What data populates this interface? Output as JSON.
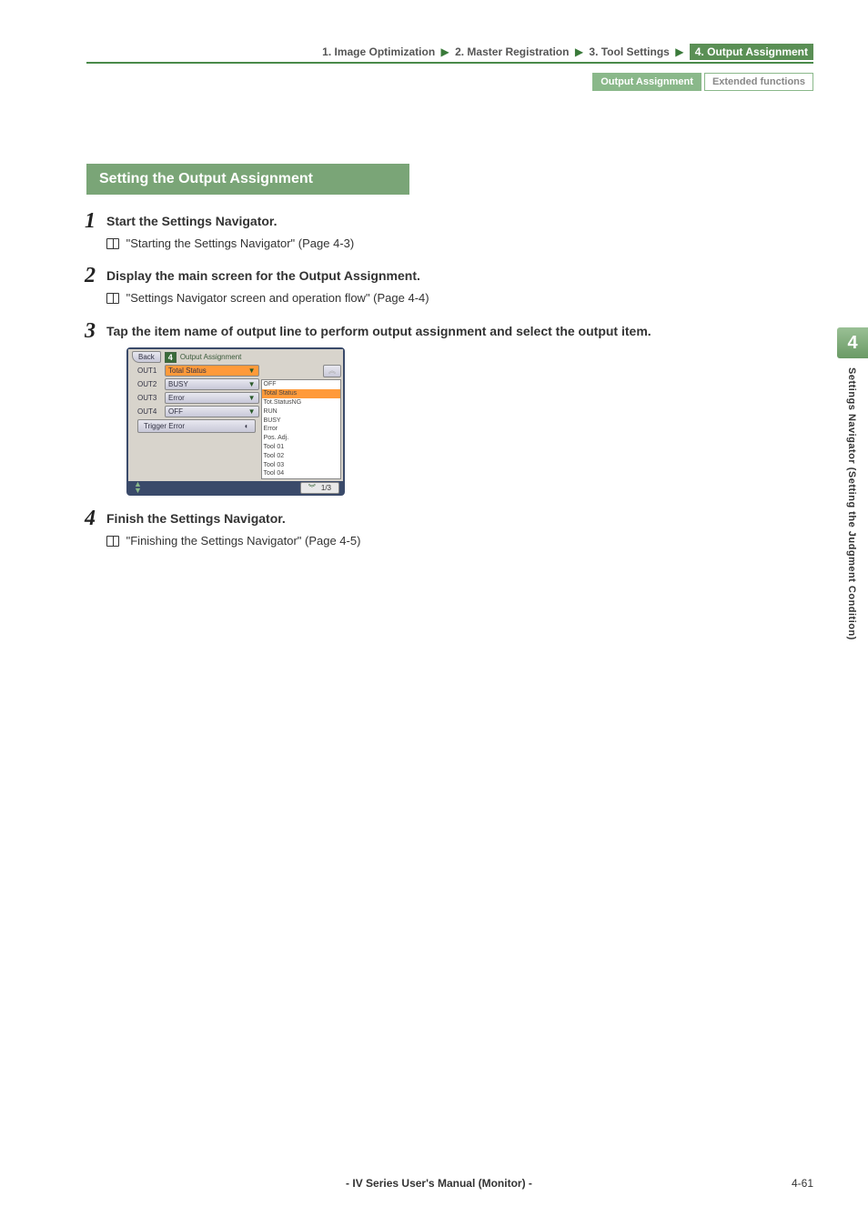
{
  "breadcrumb": {
    "items": [
      "1. Image Optimization",
      "2. Master Registration",
      "3. Tool Settings",
      "4. Output Assignment"
    ],
    "active_index": 3
  },
  "subtabs": {
    "items": [
      "Output Assignment",
      "Extended functions"
    ],
    "active_index": 0
  },
  "section_heading": "Setting the Output Assignment",
  "steps": [
    {
      "num": "1",
      "title": "Start the Settings Navigator.",
      "ref": "\"Starting the Settings Navigator\" (Page 4-3)"
    },
    {
      "num": "2",
      "title": "Display the main screen for the Output Assignment.",
      "ref": "\"Settings Navigator screen and operation flow\" (Page 4-4)"
    },
    {
      "num": "3",
      "title": "Tap the item name of output line to perform output assignment and select the output item.",
      "ref": ""
    },
    {
      "num": "4",
      "title": "Finish the Settings Navigator.",
      "ref": "\"Finishing the Settings Navigator\" (Page 4-5)"
    }
  ],
  "device": {
    "back": "Back",
    "stage_num": "4",
    "stage_title": "Output Assignment",
    "rows": [
      {
        "label": "OUT1",
        "value": "Total Status",
        "selected": true
      },
      {
        "label": "OUT2",
        "value": "BUSY",
        "selected": false
      },
      {
        "label": "OUT3",
        "value": "Error",
        "selected": false
      },
      {
        "label": "OUT4",
        "value": "OFF",
        "selected": false
      }
    ],
    "trigger_label": "Trigger Error",
    "dropdown": [
      "OFF",
      "Total Status",
      "Tot.StatusNG",
      "RUN",
      "BUSY",
      "Error",
      "Pos. Adj.",
      "Tool 01",
      "Tool 02",
      "Tool 03",
      "Tool 04"
    ],
    "dropdown_selected_index": 1,
    "page_indicator": "1/3"
  },
  "sidetab": {
    "num": "4",
    "text": "Settings Navigator (Setting the Judgment Condition)"
  },
  "footer": {
    "center": "- IV Series User's Manual (Monitor) -",
    "page": "4-61"
  }
}
